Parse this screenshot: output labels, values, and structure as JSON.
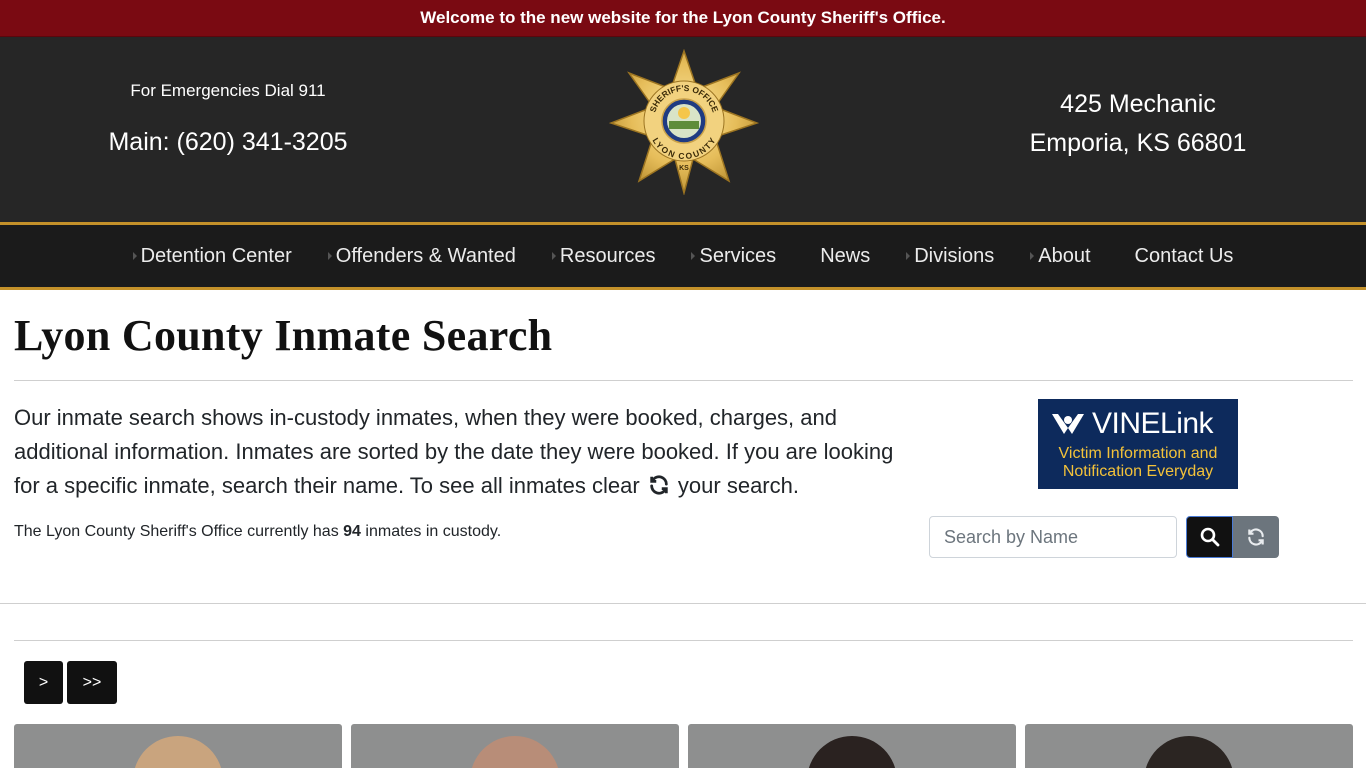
{
  "announcement": "Welcome to the new website for the Lyon County Sheriff's Office.",
  "header": {
    "emergency": "For Emergencies Dial 911",
    "main_phone": "Main: (620) 341-3205",
    "address_line1": "425 Mechanic",
    "address_line2": "Emporia, KS 66801",
    "badge": {
      "top_text": "SHERIFF'S OFFICE",
      "bottom_text": "LYON COUNTY",
      "state_abbr": "KS"
    }
  },
  "nav": {
    "items": [
      {
        "label": "Detention Center",
        "caret": true
      },
      {
        "label": "Offenders & Wanted",
        "caret": true
      },
      {
        "label": "Resources",
        "caret": true
      },
      {
        "label": "Services",
        "caret": true
      },
      {
        "label": "News",
        "caret": false
      },
      {
        "label": "Divisions",
        "caret": true
      },
      {
        "label": "About",
        "caret": true
      },
      {
        "label": "Contact Us",
        "caret": false
      }
    ]
  },
  "page": {
    "title": "Lyon County Inmate Search",
    "intro_before_icon": "Our inmate search shows in-custody inmates, when they were booked, charges, and additional information. Inmates are sorted by the date they were booked. If you are looking for a specific inmate, search their name. To see all inmates clear",
    "intro_after_icon": "your search.",
    "count_prefix": "The Lyon County Sheriff's Office currently has",
    "count_value": "94",
    "count_suffix": "inmates in custody."
  },
  "vine": {
    "brand": "VINELink",
    "tagline_line1": "Victim Information and",
    "tagline_line2": "Notification Everyday"
  },
  "search": {
    "placeholder": "Search by Name",
    "search_icon": "search-icon",
    "clear_icon": "refresh-icon"
  },
  "pagination": {
    "next_label": ">",
    "last_label": ">>"
  },
  "colors": {
    "announcement_bg": "#7a0a12",
    "header_bg": "#262626",
    "nav_bg": "#1b1b1b",
    "gold_accent": "#c4912a",
    "vine_bg": "#0d2a5c",
    "vine_tagline": "#f3c23a"
  }
}
